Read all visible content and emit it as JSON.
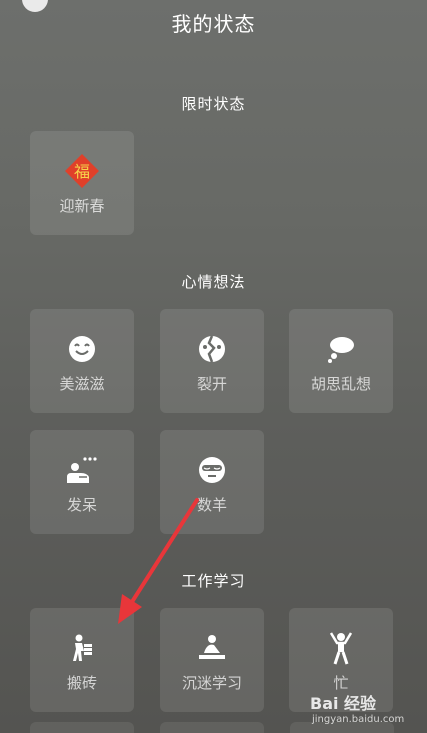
{
  "header": {
    "title": "我的状态"
  },
  "sections": {
    "limited": {
      "title": "限时状态",
      "items": [
        {
          "label": "迎新春",
          "icon": "fu-badge-icon"
        }
      ]
    },
    "mood": {
      "title": "心情想法",
      "items": [
        {
          "label": "美滋滋",
          "icon": "smile-icon"
        },
        {
          "label": "裂开",
          "icon": "cracked-face-icon"
        },
        {
          "label": "胡思乱想",
          "icon": "thought-cloud-icon"
        },
        {
          "label": "发呆",
          "icon": "daze-icon"
        },
        {
          "label": "数羊",
          "icon": "sleep-mask-icon"
        }
      ]
    },
    "work": {
      "title": "工作学习",
      "items": [
        {
          "label": "搬砖",
          "icon": "brick-carrier-icon"
        },
        {
          "label": "沉迷学习",
          "icon": "studying-icon"
        },
        {
          "label": "忙",
          "icon": "busy-person-icon"
        }
      ]
    }
  },
  "fu_glyph": "福",
  "annotation": {
    "color": "#e8363a"
  },
  "watermark": {
    "main": "Bai 经验",
    "sub": "jingyan.baidu.com"
  }
}
